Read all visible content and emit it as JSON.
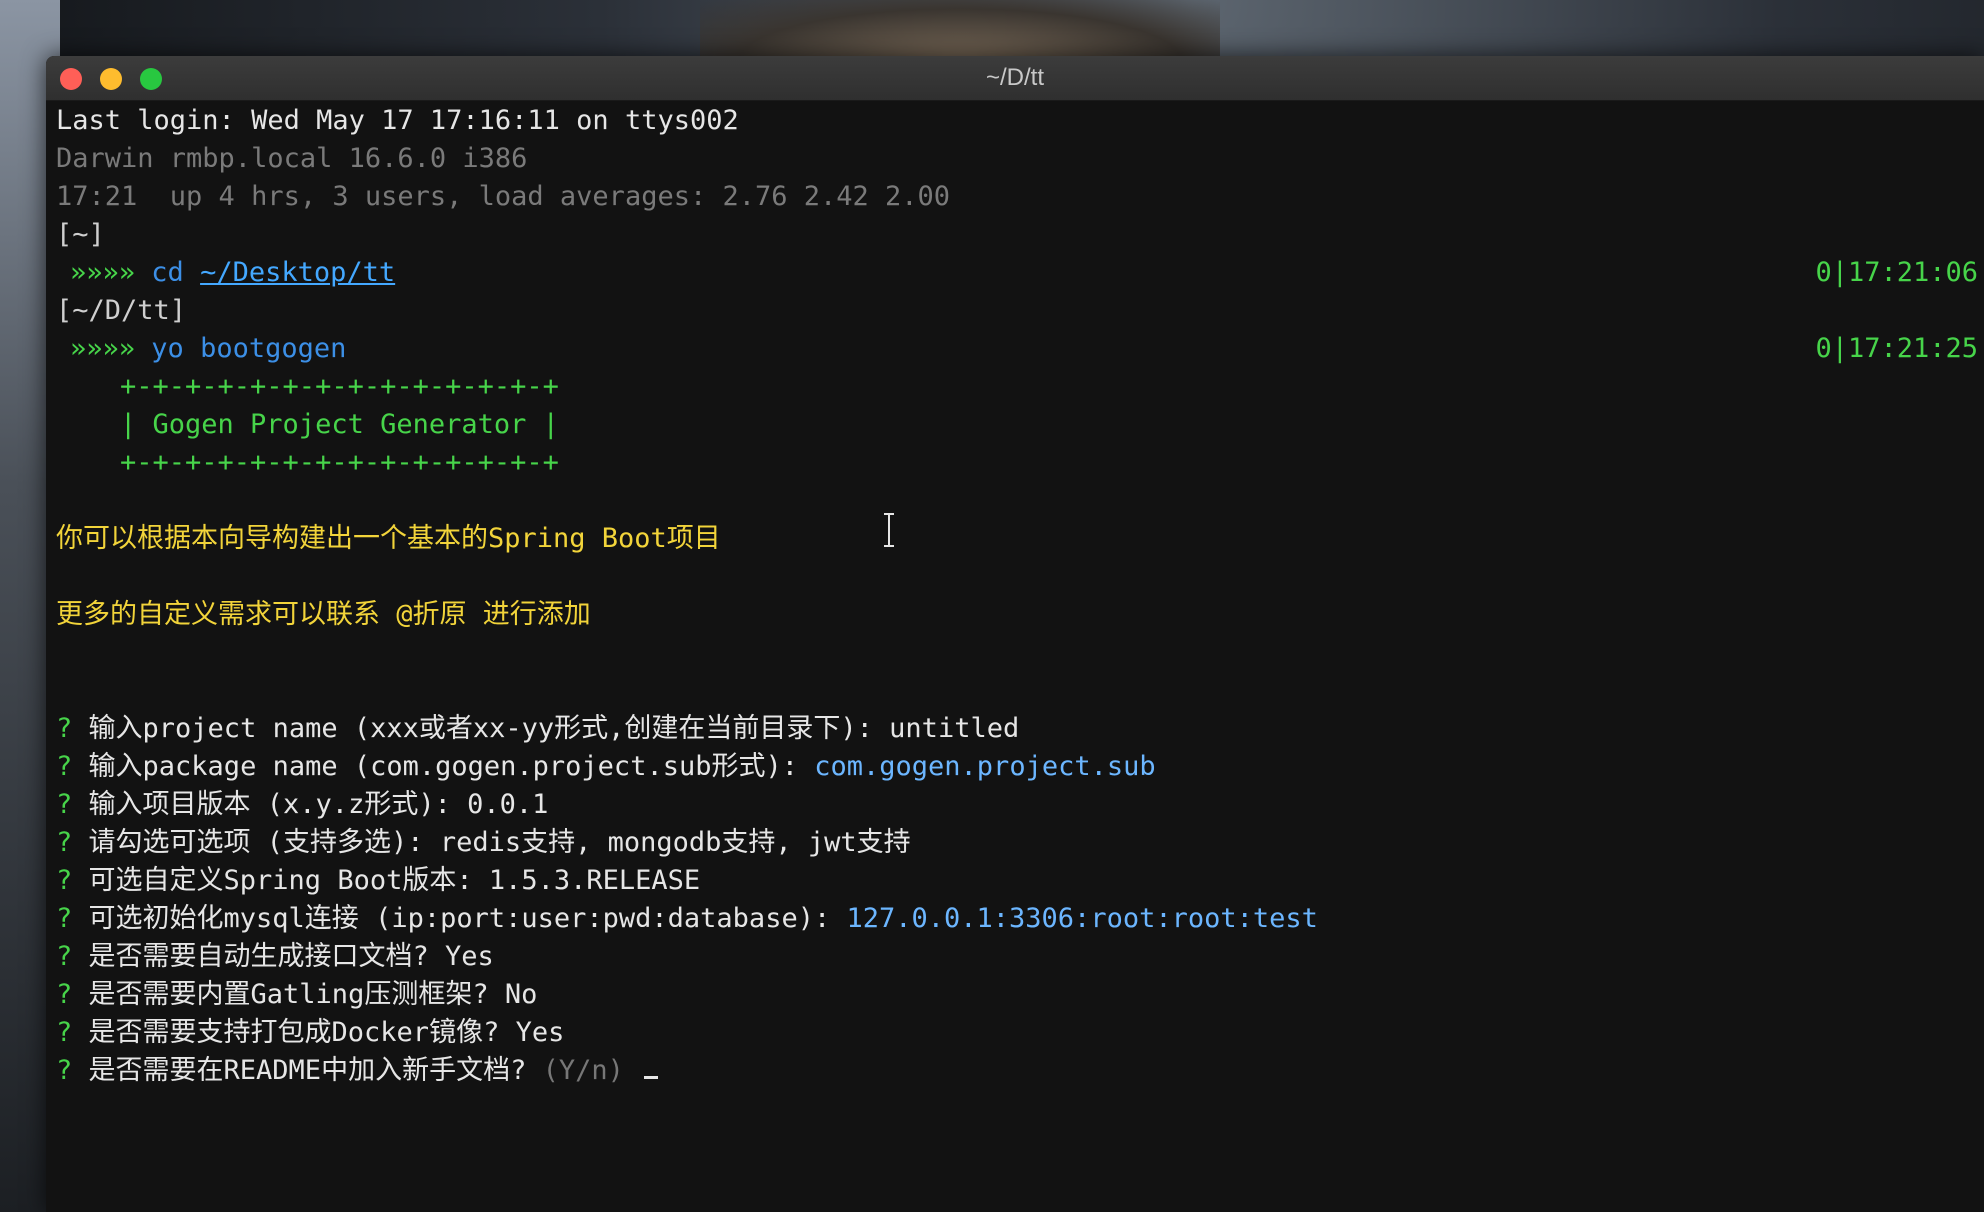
{
  "window": {
    "title": "~/D/tt"
  },
  "terminal": {
    "last_login": "Last login: Wed May 17 17:16:11 on ttys002",
    "uname": "Darwin rmbp.local 16.6.0 i386",
    "uptime": "17:21  up 4 hrs, 3 users, load averages: 2.76 2.42 2.00",
    "dir1": "[~]",
    "prompt_arrows": "»»»»",
    "cmd1": {
      "cmd": "cd",
      "arg": "~/Desktop/tt",
      "time": "0|17:21:06"
    },
    "dir2": "[~/D/tt]",
    "cmd2": {
      "cmd": "yo",
      "arg": "bootgogen",
      "time": "0|17:21:25"
    },
    "banner_border": "+-+-+-+-+-+-+-+-+-+-+-+-+-+",
    "banner_text": "| Gogen Project Generator |",
    "intro1": "你可以根据本向导构建出一个基本的Spring Boot项目",
    "intro2": "更多的自定义需求可以联系 @折原 进行添加",
    "qmark": "?",
    "questions": [
      {
        "q": "输入project name (xxx或者xx-yy形式,创建在当前目录下): ",
        "a": "untitled"
      },
      {
        "q": "输入package name (com.gogen.project.sub形式): ",
        "a": "com.gogen.project.sub"
      },
      {
        "q": "输入项目版本 (x.y.z形式): ",
        "a": "0.0.1"
      },
      {
        "q": "请勾选可选项 (支持多选): ",
        "a": "redis支持, mongodb支持, jwt支持"
      },
      {
        "q": "可选自定义Spring Boot版本: ",
        "a": "1.5.3.RELEASE"
      },
      {
        "q": "可选初始化mysql连接 (ip:port:user:pwd:database): ",
        "a": "127.0.0.1:3306:root:root:test"
      },
      {
        "q": "是否需要自动生成接口文档? ",
        "a": "Yes"
      },
      {
        "q": "是否需要内置Gatling压测框架? ",
        "a": "No"
      },
      {
        "q": "是否需要支持打包成Docker镜像? ",
        "a": "Yes"
      },
      {
        "q": "是否需要在README中加入新手文档? ",
        "a": "(Y/n)"
      }
    ]
  },
  "colors": {
    "prompt_green": "#47d44a",
    "intro_yellow": "#f2d43a",
    "answer_blue": "#6cb6ff"
  }
}
